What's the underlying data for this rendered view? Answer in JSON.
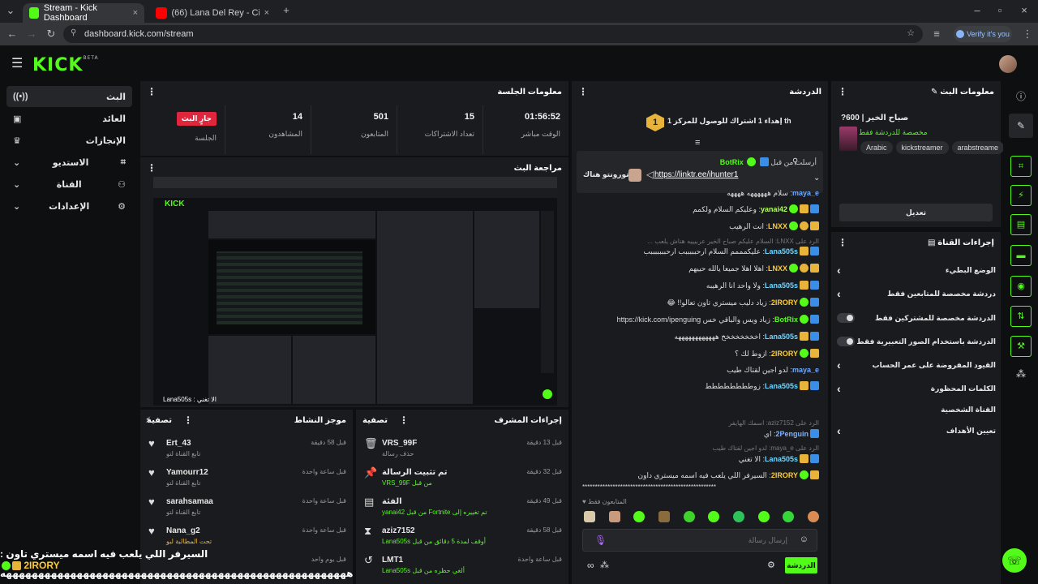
{
  "browser": {
    "tabs": [
      {
        "label": "Stream - Kick Dashboard"
      },
      {
        "label": "(66) Lana Del Rey - Cinnamon G"
      }
    ],
    "url": "dashboard.kick.com/stream",
    "verify_label": "Verify it's you"
  },
  "brand": {
    "logo": "KICK",
    "beta": "BETA",
    "accent": "#53fc18"
  },
  "leftnav": {
    "items": [
      {
        "label": "البث",
        "icon": "live-icon"
      },
      {
        "label": "العائد",
        "icon": "wallet-icon"
      },
      {
        "label": "الإنجازات",
        "icon": "trophy-icon"
      },
      {
        "label": "الاستديو",
        "icon": "studio-icon"
      },
      {
        "label": "القناة",
        "icon": "channel-icon"
      },
      {
        "label": "الإعدادات",
        "icon": "gear-icon"
      }
    ]
  },
  "session": {
    "title": "معلومات الجلسة",
    "live_badge": "جارٍ البث",
    "session_label": "الجلسة",
    "stats": [
      {
        "value": "14",
        "label": "المشاهدون"
      },
      {
        "value": "501",
        "label": "المتابعون"
      },
      {
        "value": "15",
        "label": "تعداد الاشتراكات"
      },
      {
        "value": "01:56:52",
        "label": "الوقت مباشر"
      }
    ]
  },
  "preview": {
    "title": "مراجعة البث",
    "caption": "Lana505s : الا تغني"
  },
  "activity": {
    "title": "موجز النشاط",
    "filter": "تصفية",
    "items": [
      {
        "name": "Ert_43",
        "sub": "تابع القناة لتو",
        "time": "قبل 58 دقيقة"
      },
      {
        "name": "Yamourr12",
        "sub": "تابع القناة لتو",
        "time": "قبل ساعة واحدة"
      },
      {
        "name": "sarahsamaa",
        "sub": "تابع القناة لتو",
        "time": "قبل ساعة واحدة"
      },
      {
        "name": "Nana_g2",
        "sub": "تحت المطالبة لبو",
        "time": "قبل ساعة واحدة"
      },
      {
        "name": "",
        "sub": "",
        "time": "قبل يوم واحد"
      }
    ]
  },
  "modactions": {
    "title": "إجراءات المشرف",
    "filter": "تصفية",
    "items": [
      {
        "name": "VRS_99F",
        "sub": "حذف رسالة",
        "time": "قبل 13 دقيقة"
      },
      {
        "name": "تم تثبيت الرسالة",
        "sub": "من قبل VRS_99F",
        "time": "قبل 32 دقيقة"
      },
      {
        "name": "الفئة",
        "sub": "تم تغييره إلى Fortnite من قبل yanai42",
        "time": "قبل 49 دقيقة"
      },
      {
        "name": "aziz7152",
        "sub": "أوقف لمدة 5 دقائق من قبل Lana505s",
        "time": "قبل 58 دقيقة"
      },
      {
        "name": "LMT1",
        "sub": "ألغي حظره من قبل Lana505s",
        "time": "قبل ساعة واحدة"
      }
    ]
  },
  "chat": {
    "title": "الدردشة",
    "goal": "إهداء 1 اشتراك للوصول للمركز 1 th",
    "goal_rank": "1",
    "pinned": {
      "by": "أرسلت من قبل",
      "user": "BotRix",
      "link": "https://linktr.ee/ihunter1",
      "sub": "تورونتو هناك"
    },
    "messages": [
      {
        "user": "maya_e",
        "text": "سلام ههههههه ههههه"
      },
      {
        "user": "yanai42",
        "text": "وعليكم السلام ولكمم"
      },
      {
        "user": "LNXX",
        "text": "انت الرهيب"
      },
      {
        "reply": "الرد على LNXX: السلام عليكم صباح الخير عربيييه هناش يلعب ..."
      },
      {
        "user": "Lana505s",
        "text": "عليكمممم السلام ارحبببببب ارحبببببببب"
      },
      {
        "user": "LNXX",
        "text": "اهلا اهلا جميعا يالله حييهم"
      },
      {
        "user": "Lana505s",
        "text": "ولا واحد انا الرهيبه"
      },
      {
        "user": "2IRORY",
        "text": "زياد دليب ميستري تاون تعالو!! 😂"
      },
      {
        "user": "BotRix",
        "text": "زياد ويس والباقي خس https://kick.com/ipenguing"
      },
      {
        "user": "Lana505s",
        "text": "اخخخخخخخخ ههههههههههههه"
      },
      {
        "user": "2IRORY",
        "text": "ازوط لك ؟"
      },
      {
        "user": "maya_e",
        "text": "لدو اجين لقتاك طيب"
      },
      {
        "user": "Lana505s",
        "text": "زوطططططططط"
      },
      {
        "reply": "الرد على aziz7152: اسمك الهايفر"
      },
      {
        "user": "2Penguin",
        "text": "اي"
      },
      {
        "reply": "الرد على maya_e: لدو اجين لقتاك طيب"
      },
      {
        "user": "Lana505s",
        "text": "الا تغني"
      },
      {
        "user": "2IRORY",
        "text": "السيرفر اللي يلعب فيه اسمه ميستري داون"
      }
    ],
    "followers_only": "المتابعون فقط",
    "input_placeholder": "إرسال رسالة",
    "send_label": "الدردشة"
  },
  "streaminfo": {
    "title": "معلومات البث",
    "stream_title": "صباح الخير | 600?",
    "category": "مخصصة للدردشة فقط",
    "tags": [
      "Arabic",
      "kickstreamer",
      "arabstreame"
    ],
    "edit_label": "تعديل"
  },
  "channelactions": {
    "title": "إجراءات القناة",
    "items": [
      {
        "label": "الوضع البطيء",
        "kind": "chevron"
      },
      {
        "label": "دردشة مخصصة للمتابعين فقط",
        "kind": "chevron"
      },
      {
        "label": "الدردشة مخصصة للمشتركين فقط",
        "kind": "toggle"
      },
      {
        "label": "الدردشة باستخدام الصور التعبيرية فقط",
        "kind": "toggle"
      },
      {
        "label": "القيود المفروضة على عمر الحساب",
        "kind": "chevron"
      },
      {
        "label": "الكلمات المحظورة",
        "kind": "chevron"
      }
    ],
    "personal_label": "القناة الشخصية",
    "goals_label": "تعيين الأهداف"
  },
  "overlay": {
    "ticker_user": "2IRORY",
    "ticker_text": "السيرفر اللي يلعب فيه اسمه ميستري تاون :",
    "ticker_line2": "ههههههههههههههههههههههههههههههههههههههههههههههههههههههه"
  }
}
